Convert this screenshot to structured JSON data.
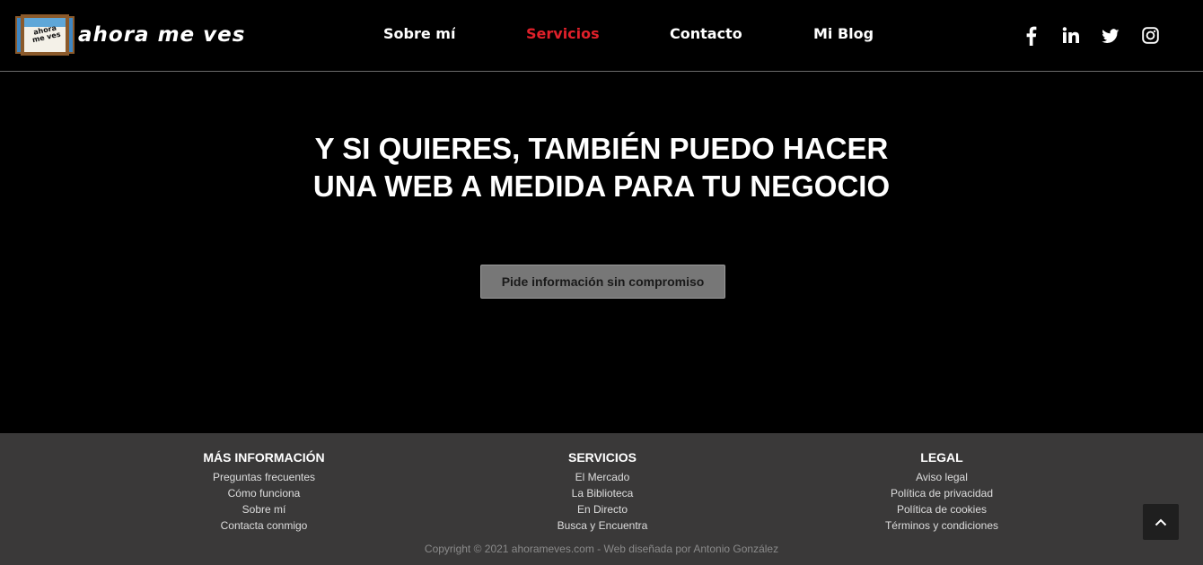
{
  "header": {
    "logo_text": "ahora me ves",
    "logo_window_text": "ahora me ves",
    "nav": [
      {
        "label": "Sobre mí",
        "active": false
      },
      {
        "label": "Servicios",
        "active": true
      },
      {
        "label": "Contacto",
        "active": false
      },
      {
        "label": "Mi Blog",
        "active": false
      }
    ],
    "social": [
      "facebook-icon",
      "linkedin-icon",
      "twitter-icon",
      "instagram-icon"
    ]
  },
  "hero": {
    "title_line1": "Y SI QUIERES, TAMBIÉN PUEDO HACER",
    "title_line2": "UNA WEB A MEDIDA PARA TU NEGOCIO",
    "cta_label": "Pide información sin compromiso"
  },
  "footer": {
    "columns": [
      {
        "heading": "MÁS INFORMACIÓN",
        "links": [
          "Preguntas frecuentes",
          "Cómo funciona",
          "Sobre mí",
          "Contacta conmigo"
        ]
      },
      {
        "heading": "SERVICIOS",
        "links": [
          "El Mercado",
          "La Biblioteca",
          "En Directo",
          "Busca y Encuentra"
        ]
      },
      {
        "heading": "LEGAL",
        "links": [
          "Aviso legal",
          "Política de privacidad",
          "Política de cookies",
          "Términos y condiciones"
        ]
      }
    ],
    "copyright": "Copyright © 2021 ahorameves.com - Web diseñada por Antonio González"
  },
  "colors": {
    "accent": "#e0202a",
    "background": "#000000",
    "footer_bg": "#3a3939",
    "button_bg": "#777777"
  }
}
